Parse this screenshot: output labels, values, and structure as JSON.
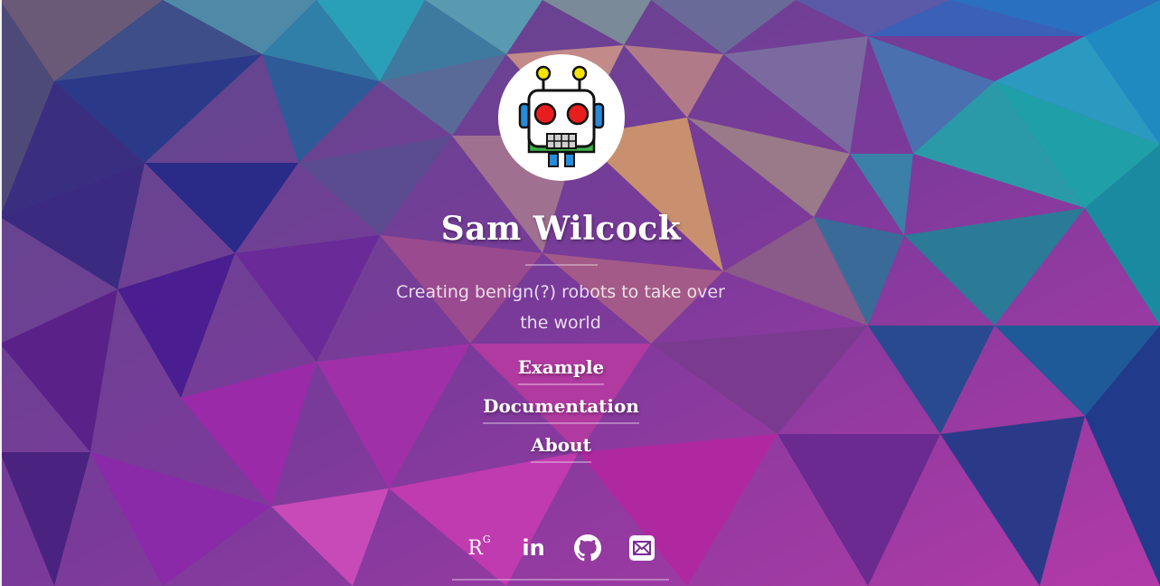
{
  "profile": {
    "name": "Sam Wilcock",
    "tagline_line1": "Creating benign(?) robots to take over",
    "tagline_line2": "the world",
    "avatar_icon": "robot-icon"
  },
  "nav": {
    "items": [
      {
        "label": "Example"
      },
      {
        "label": "Documentation"
      },
      {
        "label": "About"
      }
    ]
  },
  "social": {
    "researchgate": {
      "icon": "researchgate-icon",
      "label": "R",
      "sup": "G"
    },
    "linkedin": {
      "icon": "linkedin-icon",
      "label": "in"
    },
    "github": {
      "icon": "github-icon"
    },
    "email": {
      "icon": "email-icon"
    }
  },
  "colors": {
    "text": "#ffffff",
    "background_accent_purple": "#8b2f9e",
    "background_accent_blue": "#1f6fa8",
    "background_accent_teal": "#1f9aa0"
  }
}
